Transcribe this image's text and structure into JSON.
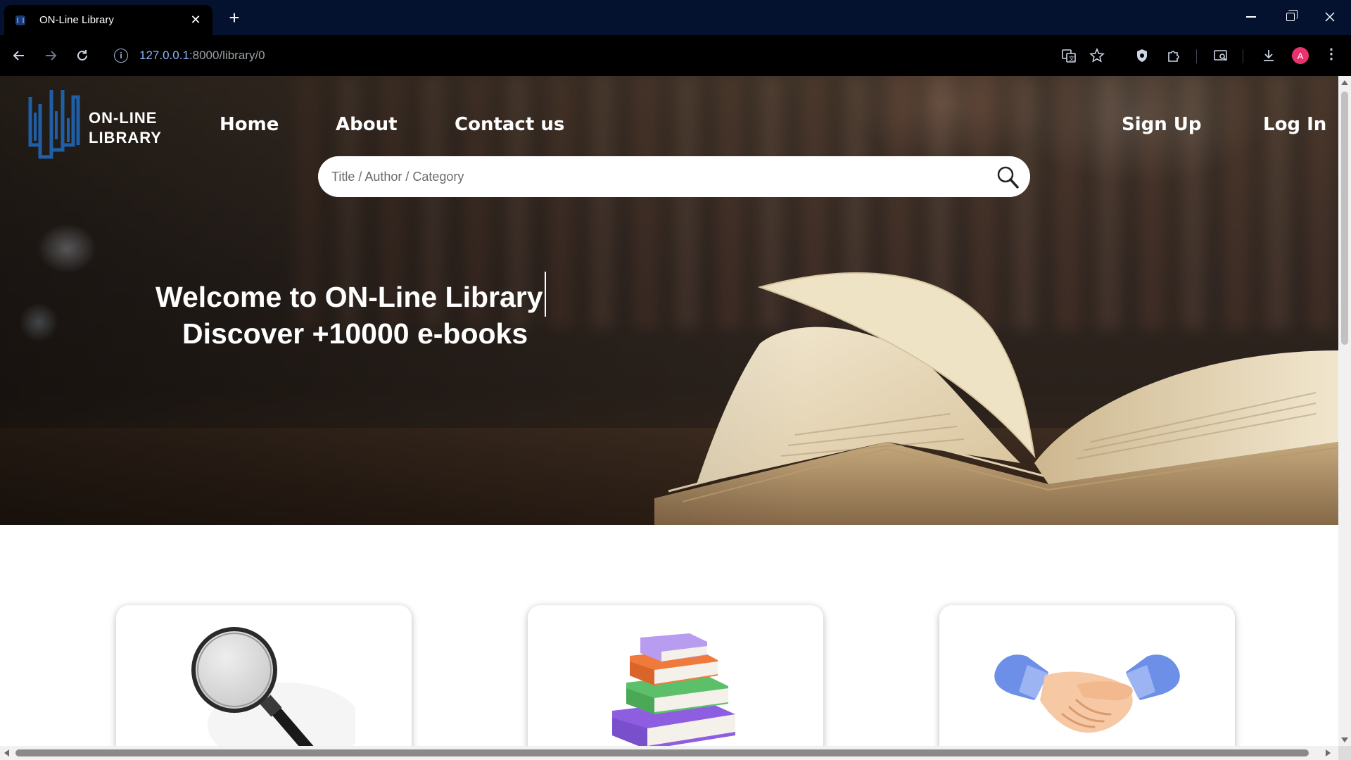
{
  "browser": {
    "tab_title": "ON-Line Library",
    "tab_close": "✕",
    "new_tab": "+",
    "url_host": "127.0.0.1",
    "url_path": ":8000/library/0",
    "profile_initial": "A",
    "icons": [
      "translate-icon",
      "bookmark-star-icon",
      "shield-extension-icon",
      "puzzle-extensions-icon",
      "screen-search-icon",
      "download-icon",
      "more-menu-icon"
    ]
  },
  "site": {
    "logo_line1": "ON-LINE",
    "logo_line2": "LIBRARY",
    "nav": {
      "home": "Home",
      "about": "About",
      "contact": "Contact us",
      "signup": "Sign Up",
      "login": "Log In"
    },
    "search": {
      "placeholder": "Title / Author / Category",
      "value": ""
    },
    "hero": {
      "title": "Welcome to ON-Line Library",
      "subtitle": "Discover +10000 e-books"
    },
    "cards": [
      {
        "icon": "magnifying-glass-icon"
      },
      {
        "icon": "book-stack-icon"
      },
      {
        "icon": "handshake-icon"
      }
    ]
  },
  "colors": {
    "logo_blue": "#1f5fa8",
    "titlebar": "#041230",
    "link_blue": "#8ab4f8"
  }
}
